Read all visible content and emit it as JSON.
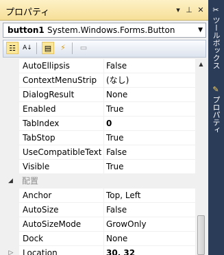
{
  "window": {
    "title": "プロパティ",
    "pin_glyph": "▾",
    "autohide_glyph": "⊥",
    "close_glyph": "✕"
  },
  "object_selector": {
    "name": "button1",
    "type": "System.Windows.Forms.Button"
  },
  "toolbar": {
    "categorized_glyph": "☷",
    "alphabetical_glyph": "A↓",
    "properties_glyph": "▤",
    "events_glyph": "⚡",
    "property_pages_glyph": "▭"
  },
  "grid": {
    "rows": [
      {
        "name": "AutoEllipsis",
        "value": "False"
      },
      {
        "name": "ContextMenuStrip",
        "value": "(なし)"
      },
      {
        "name": "DialogResult",
        "value": "None"
      },
      {
        "name": "Enabled",
        "value": "True"
      },
      {
        "name": "TabIndex",
        "value": "0"
      },
      {
        "name": "TabStop",
        "value": "True"
      },
      {
        "name": "UseCompatibleTextR",
        "value": "False"
      },
      {
        "name": "Visible",
        "value": "True"
      }
    ],
    "category": {
      "label": "配置",
      "collapse_glyph": "◢"
    },
    "layout_rows": [
      {
        "name": "Anchor",
        "value": "Top, Left"
      },
      {
        "name": "AutoSize",
        "value": "False"
      },
      {
        "name": "AutoSizeMode",
        "value": "GrowOnly"
      },
      {
        "name": "Dock",
        "value": "None"
      },
      {
        "name": "Location",
        "value": "30, 32",
        "expand_glyph": "▷"
      }
    ]
  },
  "sidebar": {
    "toolbox_label": "ツールボックス",
    "properties_label": "プロパティ"
  },
  "colors": {
    "title_bar": "#f6df98",
    "sidebar": "#2b3c59",
    "category_text": "#8c8c8c"
  }
}
